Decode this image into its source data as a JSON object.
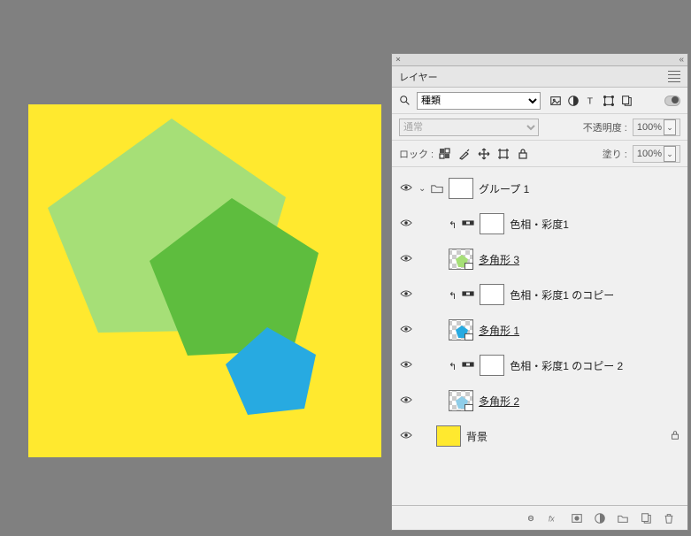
{
  "panel": {
    "title": "レイヤー",
    "filter_select": "種類",
    "blend_select": "通常",
    "opacity_label": "不透明度 :",
    "opacity_value": "100%",
    "lock_label": "ロック :",
    "fill_label": "塗り :",
    "fill_value": "100%"
  },
  "layers": {
    "group": {
      "name": "グループ 1"
    },
    "hs1": {
      "name": "色相・彩度1"
    },
    "poly3": {
      "name": "多角形 3"
    },
    "hs1c": {
      "name": "色相・彩度1 のコピー"
    },
    "poly1": {
      "name": "多角形 1"
    },
    "hs1c2": {
      "name": "色相・彩度1 のコピー 2"
    },
    "poly2": {
      "name": "多角形 2"
    },
    "bg": {
      "name": "背景"
    }
  }
}
